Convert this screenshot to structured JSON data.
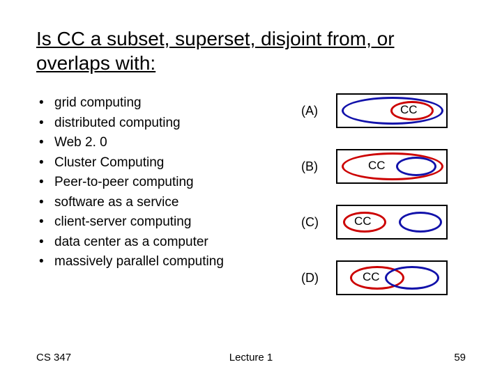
{
  "title": "Is CC a subset, superset, disjoint from, or overlaps with:",
  "bullets": [
    "grid computing",
    "distributed computing",
    "Web 2. 0",
    "Cluster Computing",
    "Peer-to-peer computing",
    "software as a service",
    "client-server computing",
    "data center as a computer",
    "massively parallel computing"
  ],
  "options": {
    "a": "(A)",
    "b": "(B)",
    "c": "(C)",
    "d": "(D)"
  },
  "cc_label": "CC",
  "footer": {
    "left": "CS 347",
    "center": "Lecture 1",
    "right": "59"
  }
}
